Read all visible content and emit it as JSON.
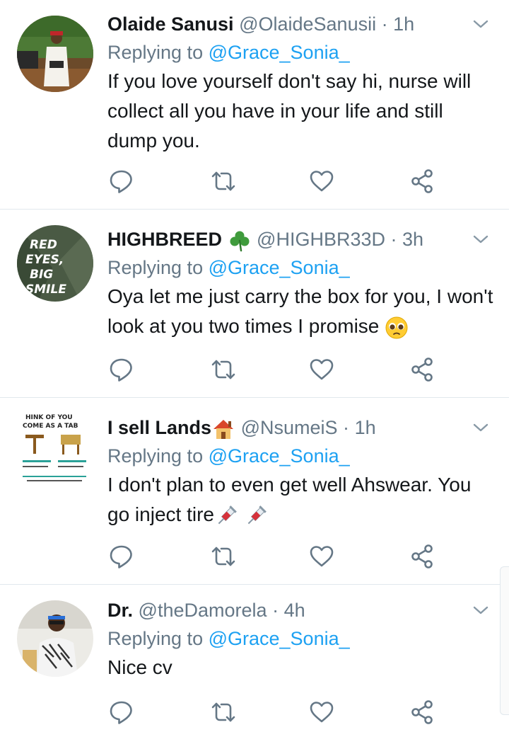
{
  "tweets": [
    {
      "name": "Olaide Sanusi",
      "handle": "@OlaideSanusii",
      "sep": "·",
      "time": "1h",
      "reply_prefix": "Replying to ",
      "reply_to": "@Grace_Sonia_",
      "text": "If you love yourself don't say hi, nurse will collect all you have in your life and still dump you."
    },
    {
      "name": "HIGHBREED",
      "name_emoji": "shamrock-icon",
      "handle": "@HIGHBR33D",
      "sep": "·",
      "time": "3h",
      "reply_prefix": "Replying to ",
      "reply_to": "@Grace_Sonia_",
      "text": "Oya let me just carry the box for you, I won't look at you two times I promise",
      "text_emoji": "pleading-face-icon",
      "avatar_text": [
        "RED",
        "EYES,",
        "BIG",
        "SMILE"
      ]
    },
    {
      "name": "I sell Lands",
      "name_emoji": "house-icon",
      "handle": "@NsumeiS",
      "sep": "·",
      "time": "1h",
      "reply_prefix": "Replying to ",
      "reply_to": "@Grace_Sonia_",
      "text": "I don't plan to even get well Ahswear. You go inject tire",
      "text_emoji": "syringe-icon",
      "avatar_text": [
        "HINK OF YOU",
        "COME AS A TAB"
      ]
    },
    {
      "name": "Dr.",
      "handle": "@theDamorela",
      "sep": "·",
      "time": "4h",
      "reply_prefix": "Replying to ",
      "reply_to": "@Grace_Sonia_",
      "text": "Nice cv"
    }
  ],
  "colors": {
    "accent": "#1da1f2",
    "muted": "#657786",
    "text": "#14171a",
    "divider": "#e1e8ed"
  },
  "icons": [
    "reply-icon",
    "retweet-icon",
    "like-icon",
    "share-icon",
    "chevron-down-icon"
  ]
}
